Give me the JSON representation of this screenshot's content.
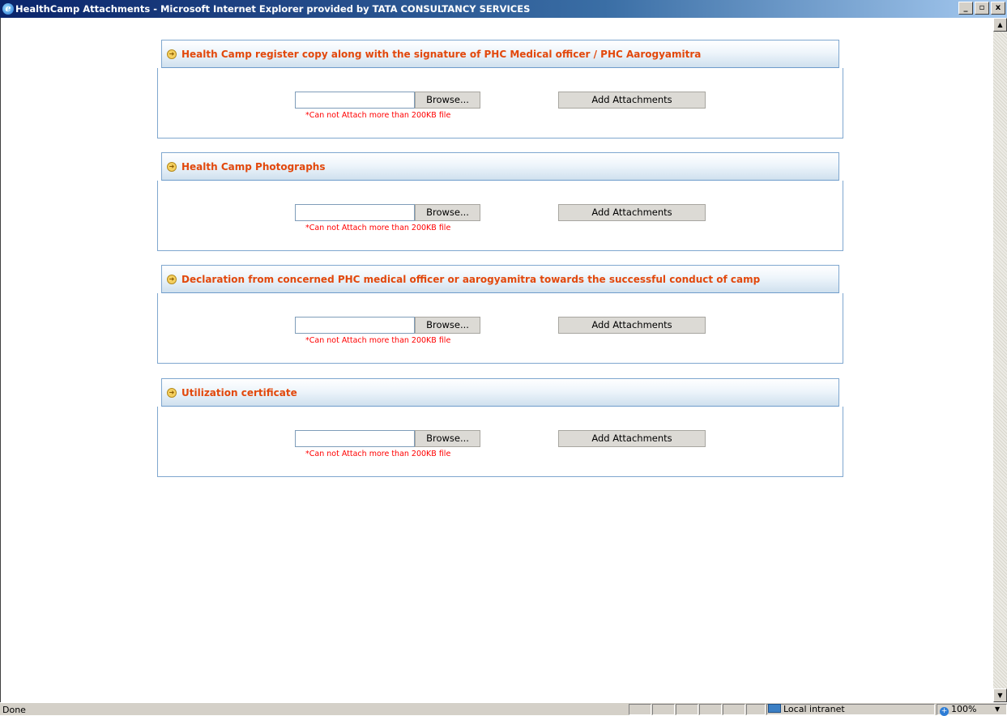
{
  "window": {
    "title": "HealthCamp Attachments - Microsoft Internet Explorer provided by TATA CONSULTANCY SERVICES",
    "app_icon": "ie-icon",
    "controls": {
      "minimize": "_",
      "maximize": "▫",
      "close": "x"
    }
  },
  "sections": [
    {
      "title": "Health Camp register copy along with the signature of PHC Medical officer / PHC Aarogyamitra",
      "browse_label": "Browse...",
      "add_label": "Add Attachments",
      "file_value": "",
      "note": "*Can not Attach more than 200KB file"
    },
    {
      "title": "Health Camp Photographs",
      "browse_label": "Browse...",
      "add_label": "Add Attachments",
      "file_value": "",
      "note": "*Can not Attach more than 200KB file"
    },
    {
      "title": "Declaration from concerned PHC medical officer or aarogyamitra towards the successful conduct of camp",
      "browse_label": "Browse...",
      "add_label": "Add Attachments",
      "file_value": "",
      "note": "*Can not Attach more than 200KB file"
    },
    {
      "title": "Utilization certificate",
      "browse_label": "Browse...",
      "add_label": "Add Attachments",
      "file_value": "",
      "note": "*Can not Attach more than 200KB file"
    }
  ],
  "statusbar": {
    "status": "Done",
    "zone": "Local intranet",
    "zoom": "100%"
  },
  "colors": {
    "section_title": "#e2480c",
    "note": "#ff0000",
    "border": "#7fa7cf"
  }
}
